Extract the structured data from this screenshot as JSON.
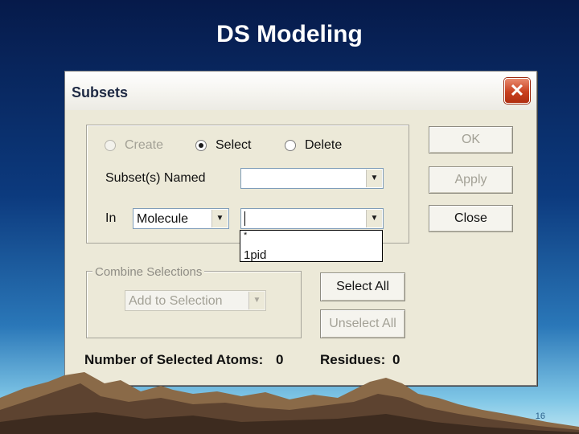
{
  "slide": {
    "title": "DS Modeling",
    "page_number": "16"
  },
  "dialog": {
    "title": "Subsets",
    "close_glyph": "✕",
    "mode_options": [
      {
        "label": "Create",
        "selected": false,
        "enabled": false
      },
      {
        "label": "Select",
        "selected": true,
        "enabled": true
      },
      {
        "label": "Delete",
        "selected": false,
        "enabled": true
      }
    ],
    "subset_named_label": "Subset(s) Named",
    "subset_named_value": "",
    "in_label": "In",
    "in_value": "Molecule",
    "in_target_value": "",
    "dropdown_options": [
      "*",
      "1pid"
    ],
    "combine_group_label": "Combine Selections",
    "combine_value": "Add to Selection",
    "buttons": {
      "ok": "OK",
      "apply": "Apply",
      "close": "Close",
      "select_all": "Select All",
      "unselect_all": "Unselect All"
    },
    "status": {
      "atoms_label": "Number of Selected Atoms:",
      "atoms_value": "0",
      "residues_label": "Residues:",
      "residues_value": "0"
    }
  }
}
